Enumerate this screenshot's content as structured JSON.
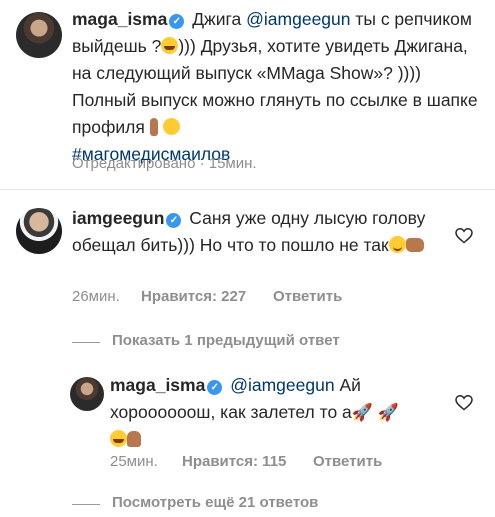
{
  "comment1": {
    "username": "maga_isma",
    "text_before": " Джига ",
    "mention": "@iamgeegun",
    "text_after": " ты с репчиком выйдешь ?",
    "text_after2": "))) Друзья, хотите увидеть Джигана, на следующий выпуск «MMaga Show»? )))) Полный выпуск можно глянуть по ссылке в шапке профиля ",
    "hashtag": "#магомедисмаилов",
    "meta": "Отредактировано · 15мин."
  },
  "comment2": {
    "username": "iamgeegun",
    "text": " Саня уже одну лысую голову обещал бить))) Но что то пошло не так",
    "time": "26мин.",
    "likes": "Нравится: 227",
    "reply_label": "Ответить"
  },
  "show_previous": "Показать 1 предыдущий ответ",
  "reply": {
    "username": "maga_isma",
    "mention": "@iamgeegun",
    "text": " Ай хороооооош, как залетел то а",
    "time": "25мин.",
    "likes": "Нравится: 115",
    "reply_label": "Ответить"
  },
  "view_more": "Посмотреть ещё 21 ответов",
  "colors": {
    "link": "#00376b",
    "meta": "#8e8e8e",
    "verified": "#3897f0"
  }
}
